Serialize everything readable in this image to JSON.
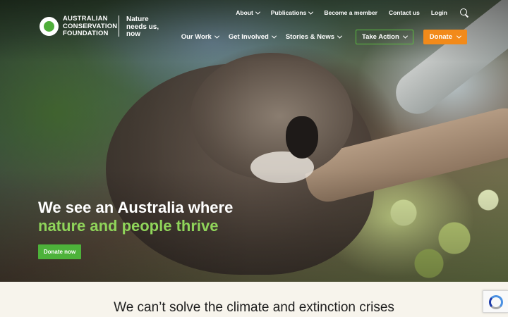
{
  "logo": {
    "org_line1": "AUSTRALIAN",
    "org_line2": "CONSERVATION",
    "org_line3": "FOUNDATION",
    "tagline_line1": "Nature",
    "tagline_line2": "needs us,",
    "tagline_line3": "now"
  },
  "top_nav": {
    "about": "About",
    "publications": "Publications",
    "become_member": "Become a member",
    "contact": "Contact us",
    "login": "Login"
  },
  "main_nav": {
    "our_work": "Our Work",
    "get_involved": "Get Involved",
    "stories_news": "Stories & News",
    "take_action": "Take Action",
    "donate": "Donate"
  },
  "hero": {
    "headline_line1": "We see an Australia where",
    "headline_line2": "nature and people thrive",
    "donate_button": "Donate now"
  },
  "section": {
    "heading": "We can’t solve the climate and extinction crises"
  },
  "colors": {
    "accent_green": "#4db23a",
    "headline_green": "#8fd45a",
    "donate_orange": "#f28a1a"
  },
  "icons": {
    "search": "search-icon",
    "chevron": "chevron-down-icon",
    "recaptcha": "recaptcha-icon"
  }
}
